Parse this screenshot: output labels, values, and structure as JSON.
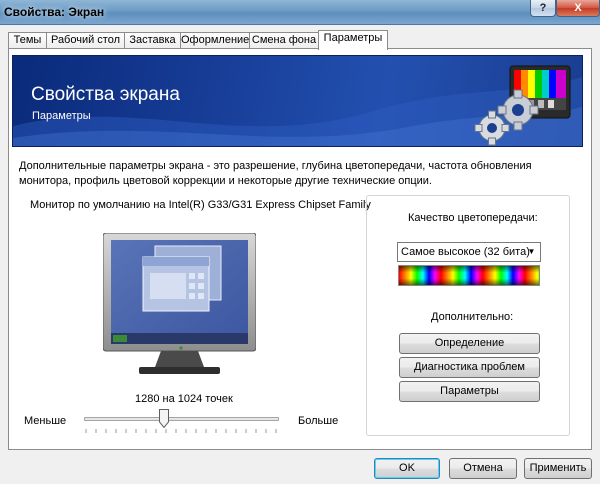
{
  "window": {
    "title": "Свойства: Экран",
    "help_glyph": "?",
    "close_glyph": "X"
  },
  "tabs": [
    {
      "label": "Темы"
    },
    {
      "label": "Рабочий стол"
    },
    {
      "label": "Заставка"
    },
    {
      "label": "Оформление"
    },
    {
      "label": "Смена фона"
    },
    {
      "label": "Параметры",
      "active": true
    }
  ],
  "banner": {
    "title": "Свойства экрана",
    "subtitle": "Параметры"
  },
  "description": "Дополнительные параметры экрана - это разрешение, глубина цветопередачи, частота обновления монитора, профиль цветовой коррекции и некоторые другие технические опции.",
  "monitor": {
    "label": "Монитор по умолчанию на Intel(R) G33/G31 Express Chipset Family"
  },
  "resolution": {
    "text": "1280 на 1024 точек",
    "less_label": "Меньше",
    "more_label": "Больше",
    "slider_fraction": 0.41
  },
  "color_quality": {
    "label": "Качество цветопередачи:",
    "selected": "Самое высокое (32 бита)"
  },
  "advanced": {
    "label": "Дополнительно:",
    "buttons": [
      "Определение",
      "Диагностика проблем",
      "Параметры"
    ]
  },
  "dialog_buttons": {
    "ok": "OK",
    "cancel": "Отмена",
    "apply": "Применить"
  },
  "colors": {
    "banner": "#173d97",
    "default_button_border": "#3c7fb1",
    "panel_bg": "#ffffff"
  },
  "icons": [
    "display-settings-gears-icon",
    "dropdown-arrow-icon",
    "slider-thumb-icon"
  ]
}
